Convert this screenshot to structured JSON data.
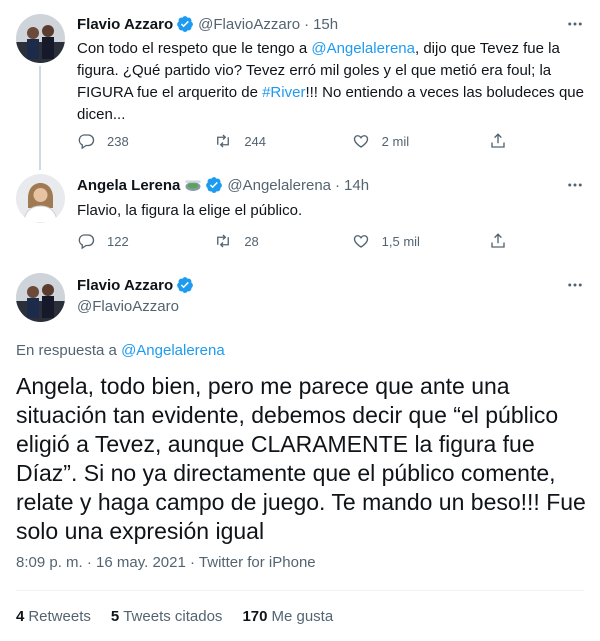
{
  "tweets": [
    {
      "name": "Flavio Azzaro",
      "handle": "@FlavioAzzaro",
      "time": "15h",
      "text_parts": {
        "a": "Con todo el respeto que le tengo a ",
        "mention": "@Angelalerena",
        "b": ", dijo que Tevez fue la figura. ¿Qué partido vio? Tevez erró mil goles y el que metió era foul; la FIGURA fue el arquerito de ",
        "hashtag": "#River",
        "c": "!!! No entiendo a veces las boludeces que dicen..."
      },
      "replies": "238",
      "retweets": "244",
      "likes": "2 mil"
    },
    {
      "name": "Angela Lerena",
      "handle": "@Angelalerena",
      "time": "14h",
      "text": "Flavio, la figura la elige el público.",
      "replies": "122",
      "retweets": "28",
      "likes": "1,5 mil"
    }
  ],
  "main": {
    "name": "Flavio Azzaro",
    "handle": "@FlavioAzzaro",
    "replying_prefix": "En respuesta a ",
    "replying_to": "@Angelalerena",
    "text": "Angela, todo bien, pero me parece que ante una situación tan evidente, debemos decir que “el público eligió a Tevez, aunque CLARAMENTE la figura fue Díaz”. Si no ya directamente que el público comente, relate y haga campo de juego. Te mando un beso!!! Fue solo una expresión igual",
    "time": "8:09 p. m.",
    "date": "16 may. 2021",
    "source": "Twitter for iPhone",
    "separator": "·",
    "retweets_count": "4",
    "retweets_label": "Retweets",
    "quotes_count": "5",
    "quotes_label": "Tweets citados",
    "likes_count": "170",
    "likes_label": "Me gusta"
  },
  "colors": {
    "accent": "#1d9bf0",
    "secondary_text": "#536471",
    "primary_text": "#0f1419"
  },
  "icons": [
    "verified-badge-icon",
    "more-options-icon",
    "reply-icon",
    "retweet-icon",
    "like-icon",
    "share-icon",
    "stadium-emoji-icon"
  ]
}
